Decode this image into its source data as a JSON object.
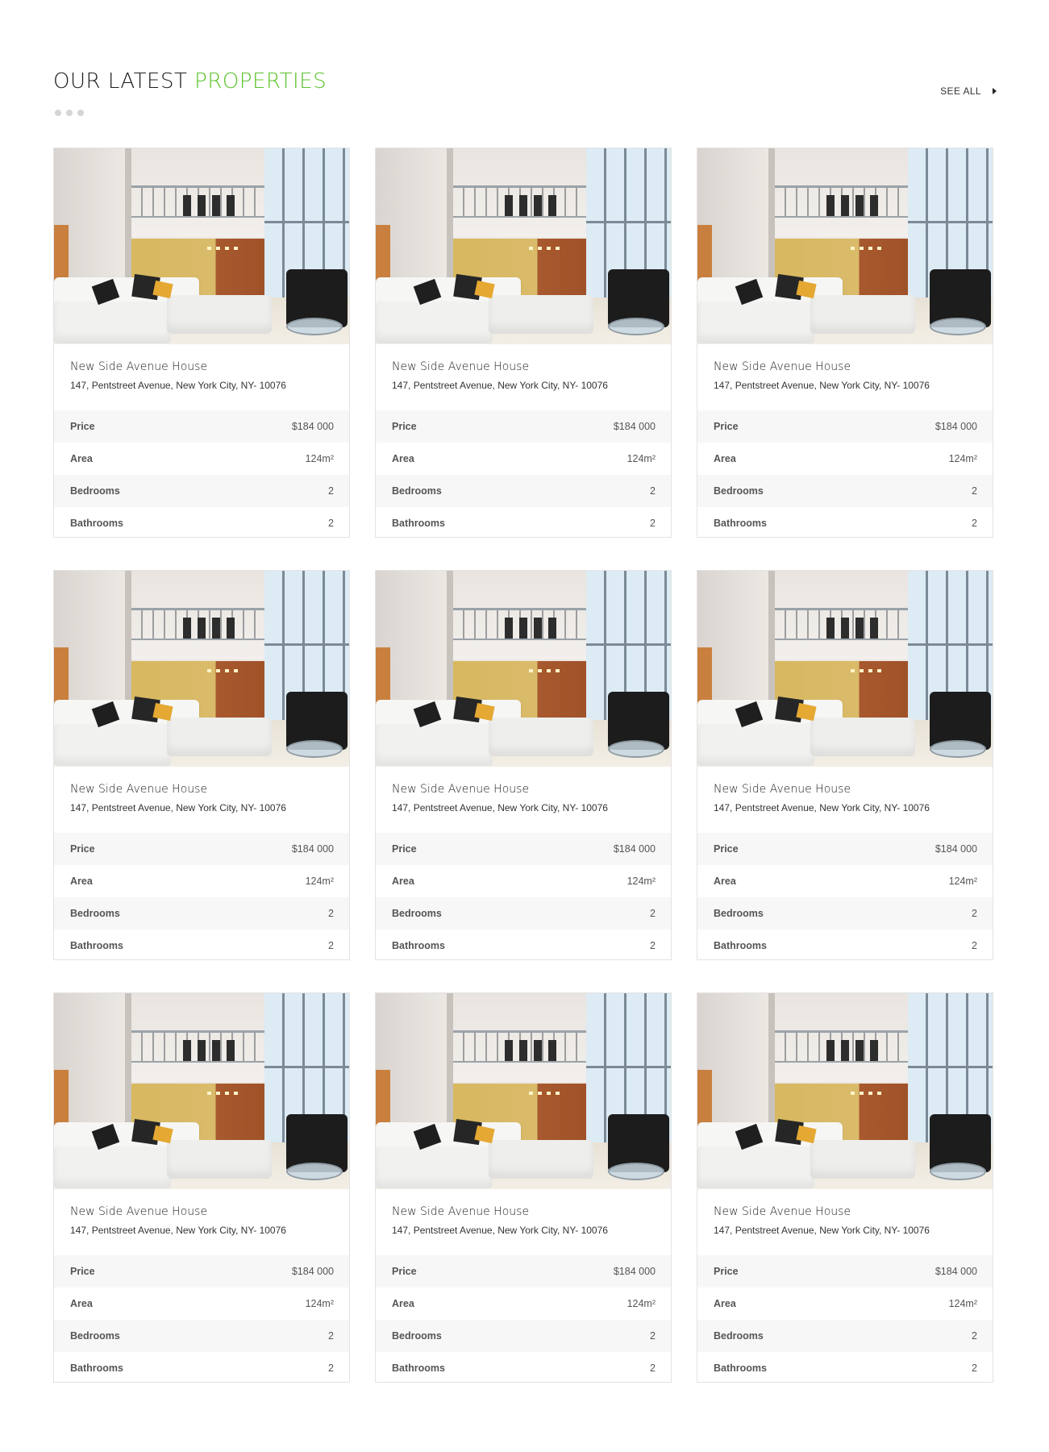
{
  "header": {
    "title_part1": "OUR LATEST ",
    "title_part2": "PROPERTIES",
    "accent_color": "#5cc22c",
    "see_all_label": "SEE ALL"
  },
  "spec_labels": {
    "price": "Price",
    "area": "Area",
    "bedrooms": "Bedrooms",
    "bathrooms": "Bathrooms"
  },
  "properties": [
    {
      "title": "New Side Avenue House",
      "address": "147, Pentstreet Avenue, New York City, NY- 10076",
      "price": "$184 000",
      "area": "124m²",
      "bedrooms": "2",
      "bathrooms": "2"
    },
    {
      "title": "New Side Avenue House",
      "address": "147, Pentstreet Avenue, New York City, NY- 10076",
      "price": "$184 000",
      "area": "124m²",
      "bedrooms": "2",
      "bathrooms": "2"
    },
    {
      "title": "New Side Avenue House",
      "address": "147, Pentstreet Avenue, New York City, NY- 10076",
      "price": "$184 000",
      "area": "124m²",
      "bedrooms": "2",
      "bathrooms": "2"
    },
    {
      "title": "New Side Avenue House",
      "address": "147, Pentstreet Avenue, New York City, NY- 10076",
      "price": "$184 000",
      "area": "124m²",
      "bedrooms": "2",
      "bathrooms": "2"
    },
    {
      "title": "New Side Avenue House",
      "address": "147, Pentstreet Avenue, New York City, NY- 10076",
      "price": "$184 000",
      "area": "124m²",
      "bedrooms": "2",
      "bathrooms": "2"
    },
    {
      "title": "New Side Avenue House",
      "address": "147, Pentstreet Avenue, New York City, NY- 10076",
      "price": "$184 000",
      "area": "124m²",
      "bedrooms": "2",
      "bathrooms": "2"
    },
    {
      "title": "New Side Avenue House",
      "address": "147, Pentstreet Avenue, New York City, NY- 10076",
      "price": "$184 000",
      "area": "124m²",
      "bedrooms": "2",
      "bathrooms": "2"
    },
    {
      "title": "New Side Avenue House",
      "address": "147, Pentstreet Avenue, New York City, NY- 10076",
      "price": "$184 000",
      "area": "124m²",
      "bedrooms": "2",
      "bathrooms": "2"
    },
    {
      "title": "New Side Avenue House",
      "address": "147, Pentstreet Avenue, New York City, NY- 10076",
      "price": "$184 000",
      "area": "124m²",
      "bedrooms": "2",
      "bathrooms": "2"
    }
  ]
}
